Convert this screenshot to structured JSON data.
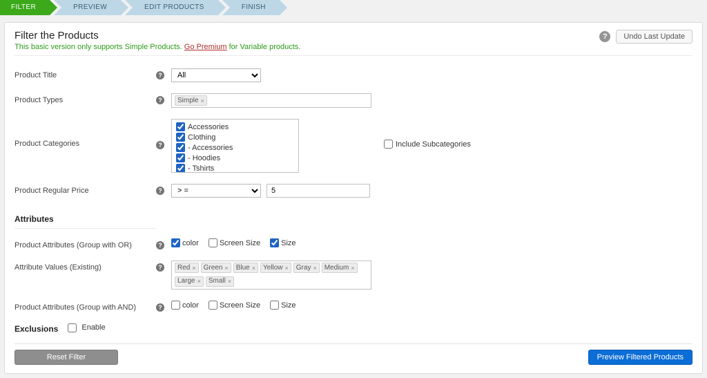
{
  "steps": [
    "FILTER",
    "PREVIEW",
    "EDIT PRODUCTS",
    "FINISH"
  ],
  "active_step": 0,
  "header": {
    "title": "Filter the Products",
    "subtitle_lead": "This basic version only supports Simple Products. ",
    "subtitle_link": "Go Premium",
    "subtitle_tail": " for Variable products.",
    "undo_label": "Undo Last Update"
  },
  "labels": {
    "product_title": "Product Title",
    "product_types": "Product Types",
    "product_categories": "Product Categories",
    "include_subcats": "Include Subcategories",
    "regular_price": "Product Regular Price",
    "attributes_section": "Attributes",
    "attrs_or": "Product Attributes (Group with OR)",
    "attr_values": "Attribute Values (Existing)",
    "attrs_and": "Product Attributes (Group with AND)",
    "exclusions_section": "Exclusions",
    "enable": "Enable",
    "reset": "Reset Filter",
    "preview": "Preview Filtered Products"
  },
  "product_title_value": "All",
  "product_types_tags": [
    "Simple"
  ],
  "category_items": [
    {
      "label": "Accessories",
      "checked": true
    },
    {
      "label": "Clothing",
      "checked": true
    },
    {
      "label": "- Accessories",
      "checked": true
    },
    {
      "label": "- Hoodies",
      "checked": true
    },
    {
      "label": "- Tshirts",
      "checked": true
    }
  ],
  "include_subcats_checked": false,
  "price_op": "> =",
  "price_value": "5",
  "attr_options": [
    "color",
    "Screen Size",
    "Size"
  ],
  "attrs_or_checked": [
    true,
    false,
    true
  ],
  "attrs_and_checked": [
    false,
    false,
    false
  ],
  "attr_value_tags": [
    "Red",
    "Green",
    "Blue",
    "Yellow",
    "Gray",
    "Medium",
    "Large",
    "Small"
  ],
  "exclusions_enabled": false
}
